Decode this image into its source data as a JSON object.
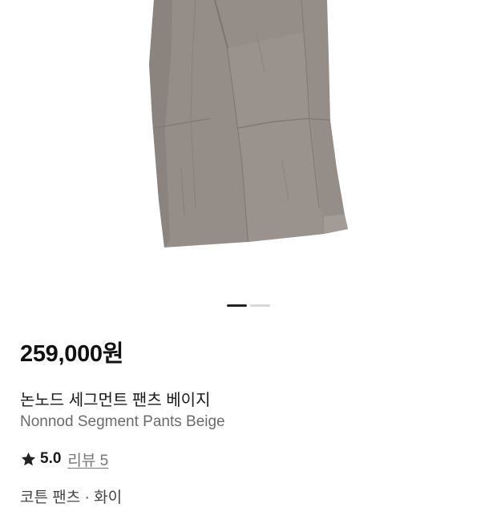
{
  "product": {
    "price": "259,000원",
    "name_ko": "논노드 세그먼트 팬츠 베이지",
    "name_en": "Nonnod Segment Pants Beige",
    "rating": "5.0",
    "review_label": "리뷰 5",
    "category": "코튼 팬츠 · 화이",
    "image_icon": "pants-product-photo"
  },
  "gallery": {
    "slide_count": 2,
    "active_index": 0
  },
  "colors": {
    "pants_fabric": "#958e88",
    "pants_shadow": "#7c7570",
    "indicator_active": "#222222",
    "indicator_inactive": "#d8d8d8",
    "star": "#222222"
  }
}
